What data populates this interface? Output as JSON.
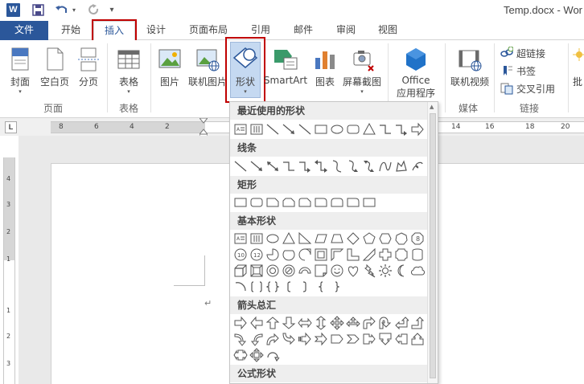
{
  "window": {
    "title": "Temp.docx - Wor",
    "logo": "W"
  },
  "qat": {
    "save_icon": "save-icon",
    "undo_icon": "undo-icon",
    "redo_icon": "redo-icon",
    "customize_icon": "chevron-down-icon"
  },
  "tabs": [
    "文件",
    "开始",
    "插入",
    "设计",
    "页面布局",
    "引用",
    "邮件",
    "审阅",
    "视图"
  ],
  "ribbon": {
    "pages_group": {
      "label": "页面",
      "cover": "封面",
      "blank": "空白页",
      "break": "分页"
    },
    "tables_group": {
      "label": "表格",
      "table": "表格"
    },
    "illustrations": {
      "picture": "图片",
      "online_picture": "联机图片",
      "shapes": "形状",
      "smartart": "SmartArt",
      "chart": "图表",
      "screenshot": "屏幕截图"
    },
    "apps": {
      "line1": "Office",
      "line2": "应用程序"
    },
    "media_group": {
      "label": "媒体",
      "online_video": "联机视频"
    },
    "links_group": {
      "label": "链接",
      "hyperlink": "超链接",
      "bookmark": "书签",
      "crossref": "交叉引用"
    },
    "comment_partial": "批"
  },
  "ruler": {
    "h_numbers": [
      "8",
      "6",
      "4",
      "2",
      "14",
      "16",
      "18",
      "20"
    ],
    "v_numbers": [
      "4",
      "3",
      "2",
      "1",
      "1",
      "2",
      "3",
      "4"
    ],
    "tab_marker": "L"
  },
  "gallery": {
    "sections": [
      "最近使用的形状",
      "线条",
      "矩形",
      "基本形状",
      "箭头总汇",
      "公式形状"
    ]
  },
  "colors": {
    "accent": "#2b579a",
    "highlight": "#c00000",
    "selected": "#c5d9f1"
  }
}
